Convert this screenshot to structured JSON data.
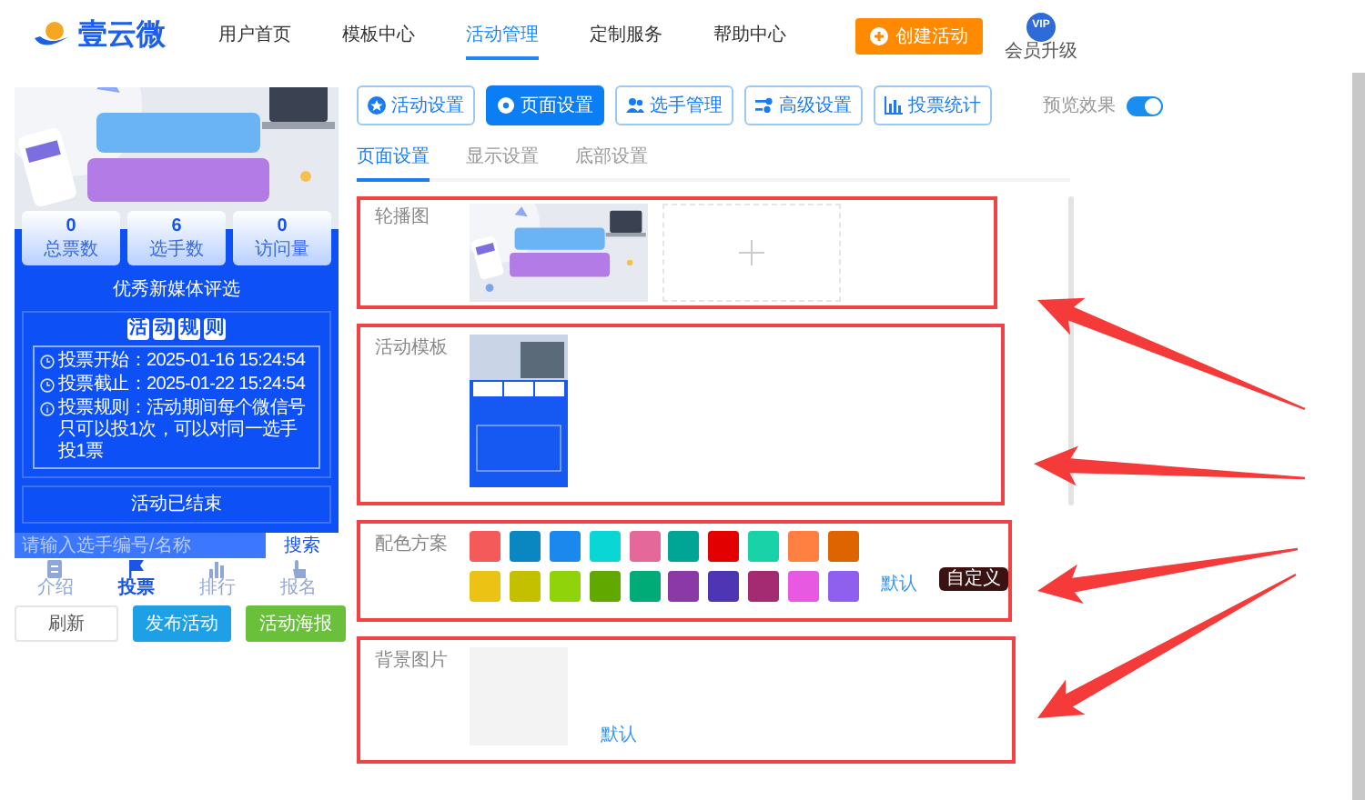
{
  "header": {
    "logo_text": "壹云微",
    "nav": [
      {
        "label": "用户首页",
        "selected": false
      },
      {
        "label": "模板中心",
        "selected": false
      },
      {
        "label": "活动管理",
        "selected": true
      },
      {
        "label": "定制服务",
        "selected": false
      },
      {
        "label": "帮助中心",
        "selected": false
      }
    ],
    "create_button": "创建活动",
    "vip": {
      "badge": "VIP",
      "label": "会员升级"
    }
  },
  "preview": {
    "stats": [
      {
        "value": "0",
        "label": "总票数"
      },
      {
        "value": "6",
        "label": "选手数"
      },
      {
        "value": "0",
        "label": "访问量"
      }
    ],
    "title": "优秀新媒体评选",
    "rules_heading": [
      "活",
      "动",
      "规",
      "则"
    ],
    "rules": [
      {
        "kind": "clock",
        "label": "投票开始：",
        "value": "2025-01-16 15:24:54"
      },
      {
        "kind": "clock",
        "label": "投票截止：",
        "value": "2025-01-22 15:24:54"
      },
      {
        "kind": "info",
        "label": "投票规则：",
        "value": "活动期间每个微信号只可以投1次，可以对同一选手投1票"
      }
    ],
    "status": "活动已结束",
    "search": {
      "placeholder": "请输入选手编号/名称",
      "button": "搜索"
    },
    "tabs": [
      {
        "kind": "list",
        "label": "介绍",
        "selected": false
      },
      {
        "kind": "flag",
        "label": "投票",
        "selected": true
      },
      {
        "kind": "chart",
        "label": "排行",
        "selected": false
      },
      {
        "kind": "hand",
        "label": "报名",
        "selected": false
      }
    ],
    "actions": [
      {
        "kind": "outline",
        "label": "刷新"
      },
      {
        "kind": "blue",
        "label": "发布活动"
      },
      {
        "kind": "green",
        "label": "活动海报"
      }
    ]
  },
  "toolbar": {
    "buttons": [
      {
        "kind": "star",
        "label": "活动设置",
        "selected": false
      },
      {
        "kind": "gear",
        "label": "页面设置",
        "selected": true
      },
      {
        "kind": "users",
        "label": "选手管理",
        "selected": false
      },
      {
        "kind": "sliders",
        "label": "高级设置",
        "selected": false
      },
      {
        "kind": "chart",
        "label": "投票统计",
        "selected": false
      }
    ],
    "preview_toggle": {
      "label": "预览效果",
      "on": true
    }
  },
  "subtabs": [
    {
      "label": "页面设置",
      "selected": true
    },
    {
      "label": "显示设置",
      "selected": false
    },
    {
      "label": "底部设置",
      "selected": false
    }
  ],
  "sections": [
    {
      "kind": "carousel",
      "label": "轮播图"
    },
    {
      "kind": "template",
      "label": "活动模板"
    },
    {
      "kind": "colors",
      "label": "配色方案",
      "colors": [
        {
          "color": "#f55a5a"
        },
        {
          "color": "#0a87c0"
        },
        {
          "color": "#1a88ec"
        },
        {
          "color": "#0ad6d6"
        },
        {
          "color": "#e4699a"
        },
        {
          "color": "#00a596"
        },
        {
          "color": "#e30000"
        },
        {
          "color": "#19d2a8"
        },
        {
          "color": "#ff8040"
        },
        {
          "color": "#de6400"
        },
        {
          "color": "#ecc314"
        },
        {
          "color": "#c4c000"
        },
        {
          "color": "#91d30b"
        },
        {
          "color": "#61a800"
        },
        {
          "color": "#01ab78"
        },
        {
          "color": "#8a39a6"
        },
        {
          "color": "#4e35b2"
        },
        {
          "color": "#a42b72"
        },
        {
          "color": "#e659e0"
        },
        {
          "color": "#8f5fee"
        }
      ],
      "default_link": "默认",
      "custom_button": "自定义"
    },
    {
      "kind": "background",
      "label": "背景图片",
      "default_link": "默认"
    }
  ]
}
